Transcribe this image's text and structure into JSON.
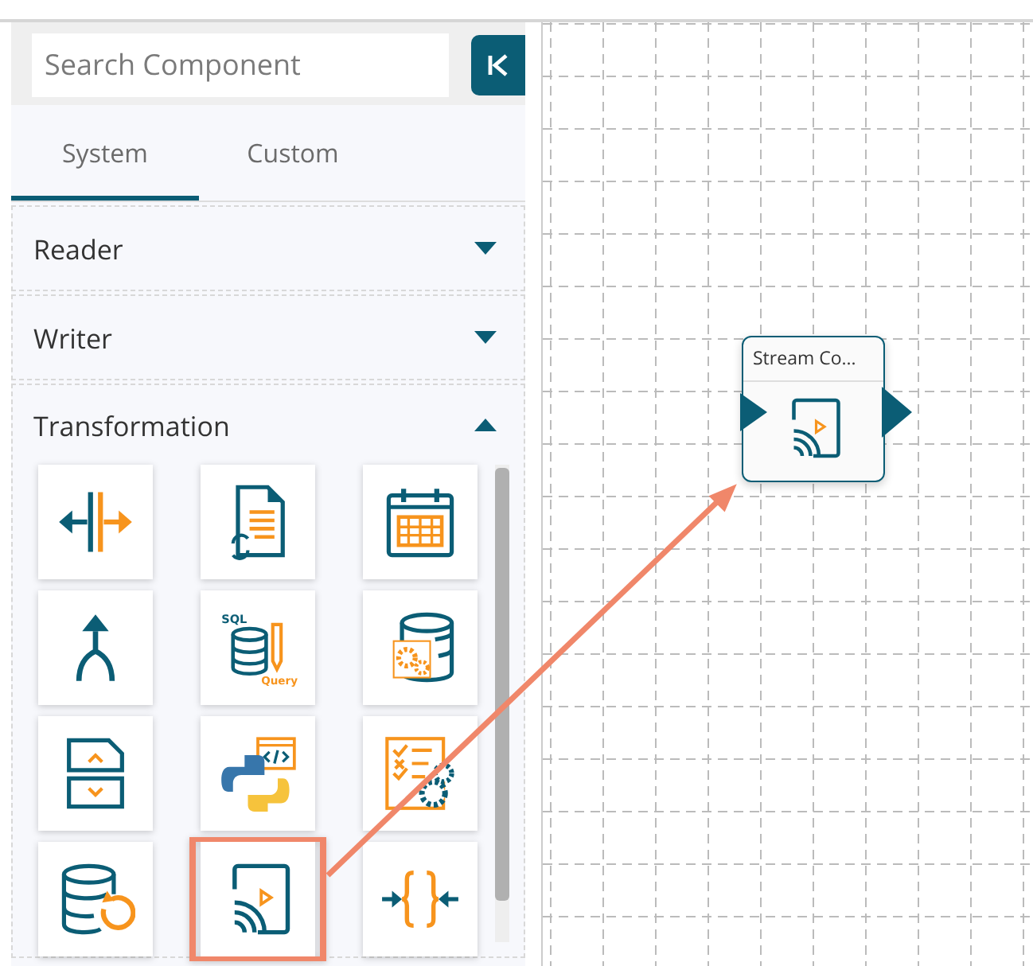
{
  "search": {
    "placeholder": "Search Component"
  },
  "tabs": [
    {
      "label": "System",
      "selected": true
    },
    {
      "label": "Custom",
      "selected": false
    }
  ],
  "sections": [
    {
      "title": "Reader",
      "expanded": false
    },
    {
      "title": "Writer",
      "expanded": false
    },
    {
      "title": "Transformation",
      "expanded": true,
      "components": [
        {
          "kind": "split",
          "highlighted": false
        },
        {
          "kind": "document",
          "highlighted": false
        },
        {
          "kind": "calendar",
          "highlighted": false
        },
        {
          "kind": "merge",
          "highlighted": false
        },
        {
          "kind": "sql",
          "highlighted": false,
          "labels": [
            "SQL",
            "Query"
          ]
        },
        {
          "kind": "dbgear",
          "highlighted": false
        },
        {
          "kind": "filesplit",
          "highlighted": false
        },
        {
          "kind": "python",
          "highlighted": false
        },
        {
          "kind": "checklist",
          "highlighted": false
        },
        {
          "kind": "dbrefresh",
          "highlighted": false
        },
        {
          "kind": "stream",
          "highlighted": true
        },
        {
          "kind": "braces",
          "highlighted": false
        }
      ]
    }
  ],
  "canvas": {
    "nodes": [
      {
        "title": "Stream Co...",
        "kind": "stream"
      }
    ]
  }
}
